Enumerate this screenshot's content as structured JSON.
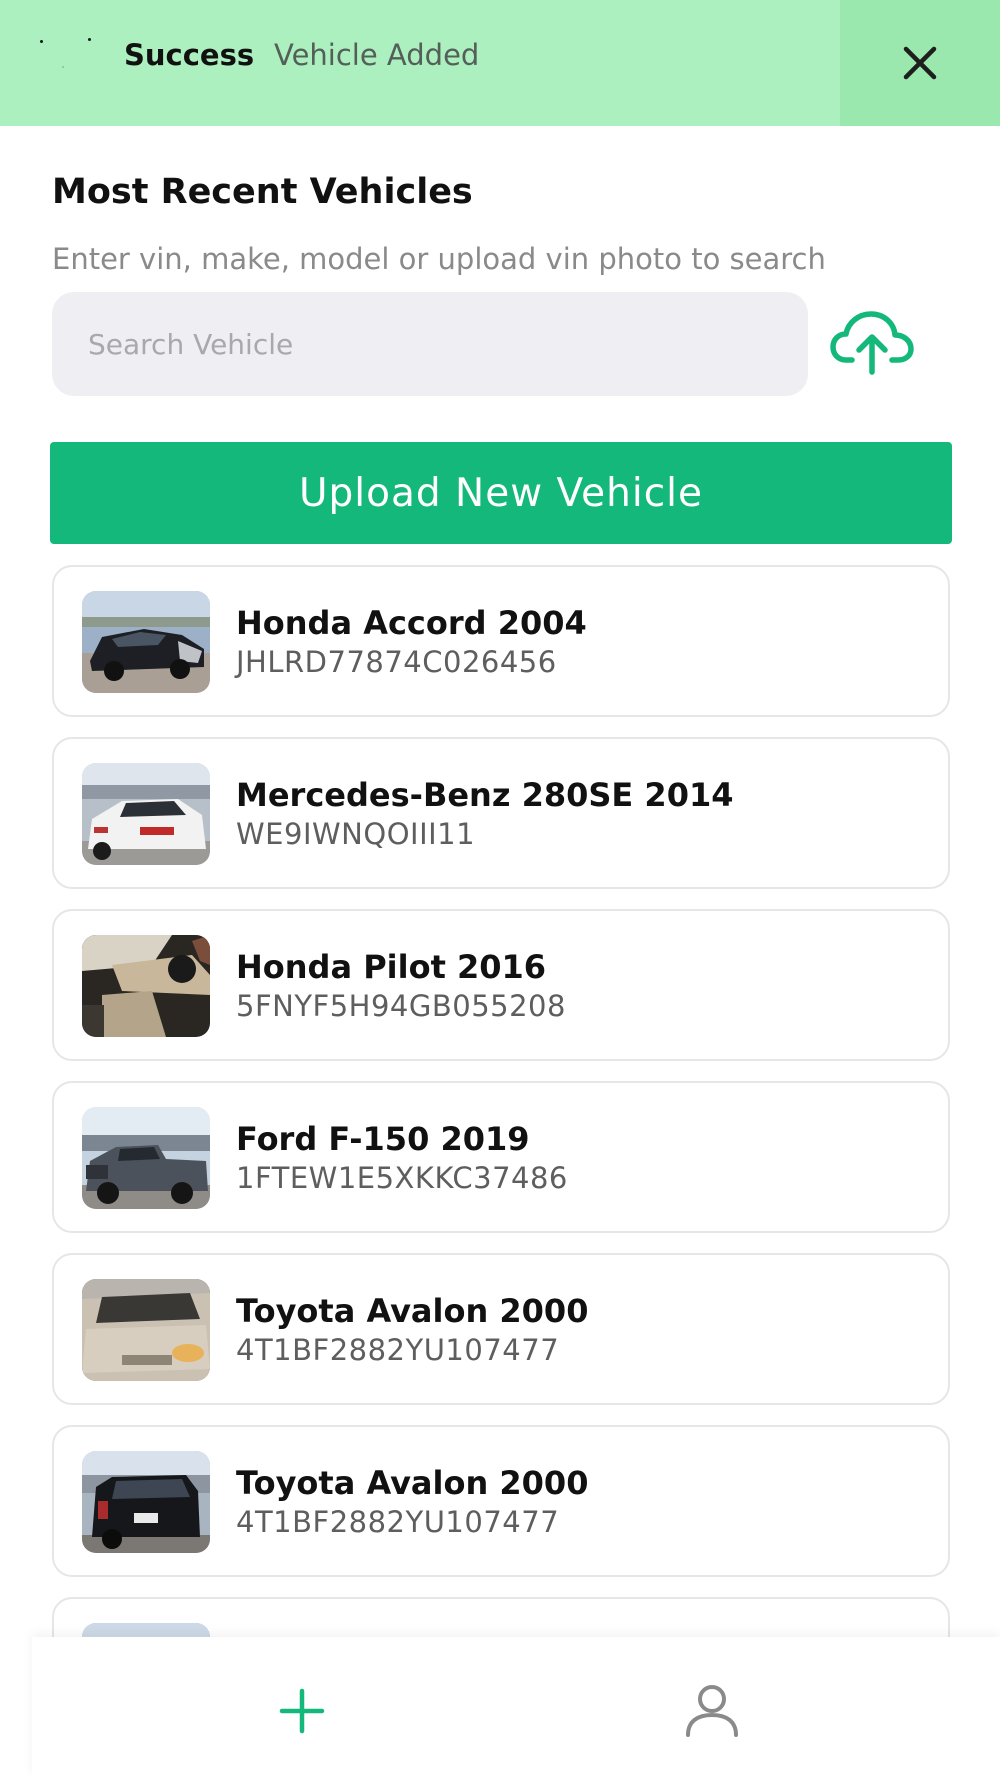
{
  "toast": {
    "title": "Success",
    "message": "Vehicle Added",
    "close_icon": "close-icon",
    "background_color": "#abf0be"
  },
  "header": {
    "title": "Most Recent Vehicles",
    "helper_text": "Enter vin, make, model or upload vin photo to search"
  },
  "search": {
    "placeholder": "Search Vehicle",
    "value": "",
    "upload_icon": "cloud-upload-icon"
  },
  "upload_button": {
    "label": "Upload New Vehicle",
    "color": "#14b87a"
  },
  "vehicles": [
    {
      "name": "Honda Accord 2004",
      "vin": "JHLRD77874C026456",
      "photo": "dark-sedan-damaged"
    },
    {
      "name": "Mercedes-Benz 280SE 2014",
      "vin": "WE9IWNQOIII11",
      "photo": "white-sedan-rear"
    },
    {
      "name": "Honda Pilot 2016",
      "vin": "5FNYF5H94GB055208",
      "photo": "interior-dashboard"
    },
    {
      "name": "Ford F-150 2019",
      "vin": "1FTEW1E5XKKC37486",
      "photo": "gray-pickup"
    },
    {
      "name": "Toyota Avalon 2000",
      "vin": "4T1BF2882YU107477",
      "photo": "silver-hatchback-front"
    },
    {
      "name": "Toyota Avalon 2000",
      "vin": "4T1BF2882YU107477",
      "photo": "black-hatchback-rear"
    },
    {
      "name": "",
      "vin": "",
      "photo": "partial-next-card"
    }
  ],
  "bottom_nav": {
    "items": [
      {
        "icon": "plus-icon",
        "color": "#14b87a"
      },
      {
        "icon": "user-icon",
        "color": "#8a8a8a"
      }
    ]
  }
}
